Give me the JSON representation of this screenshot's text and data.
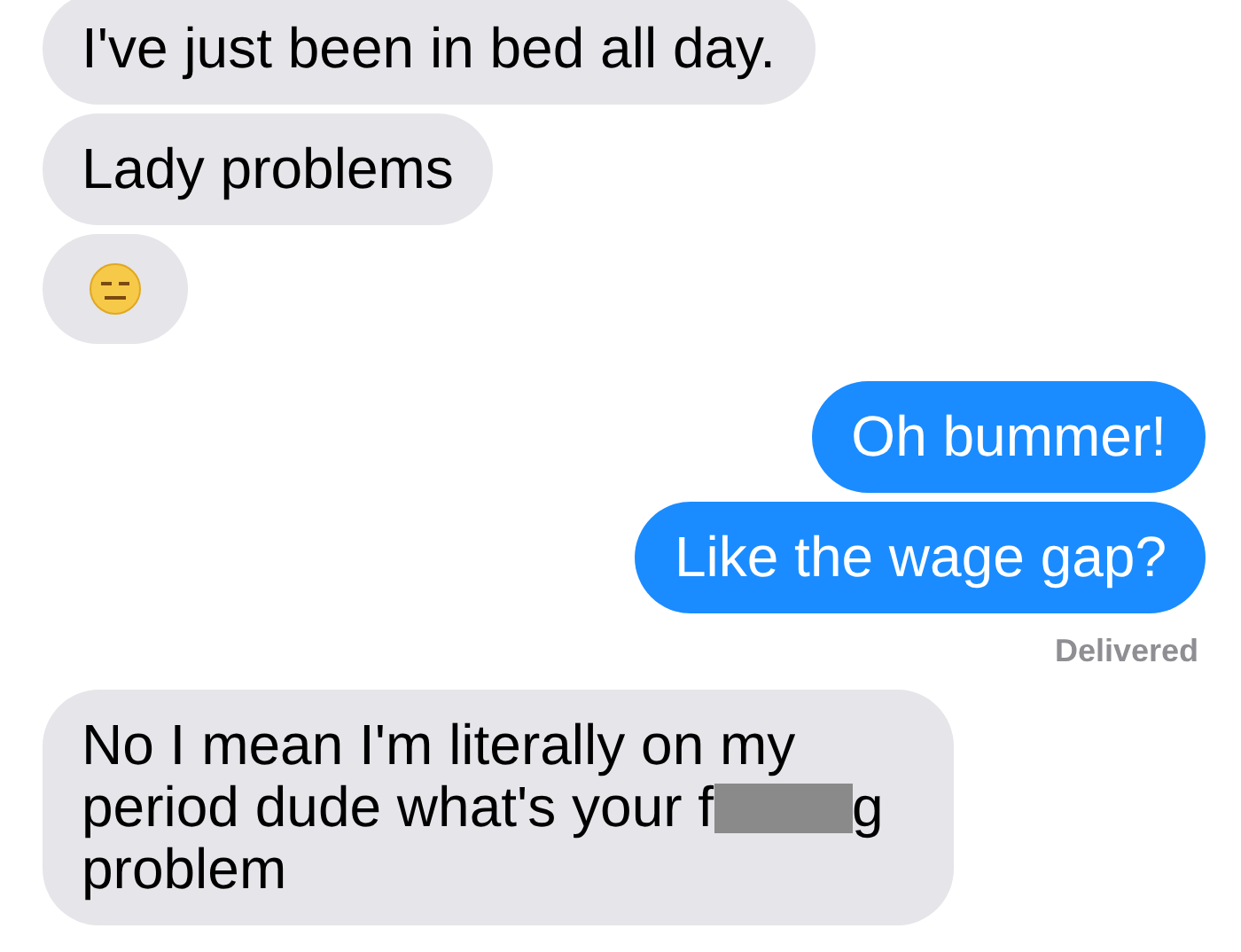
{
  "messages": [
    {
      "kind": "text",
      "outgoing": false,
      "segments": [
        {
          "kind": "text",
          "text": "I've just been in bed all day."
        }
      ]
    },
    {
      "kind": "text",
      "outgoing": false,
      "segments": [
        {
          "kind": "text",
          "text": "Lady problems"
        }
      ]
    },
    {
      "kind": "emoji",
      "outgoing": false
    },
    {
      "kind": "text",
      "outgoing": true,
      "segments": [
        {
          "kind": "text",
          "text": "Oh bummer!"
        }
      ]
    },
    {
      "kind": "text",
      "outgoing": true,
      "segments": [
        {
          "kind": "text",
          "text": "Like the wage gap?"
        }
      ]
    },
    {
      "kind": "status",
      "text": "Delivered"
    },
    {
      "kind": "text",
      "outgoing": false,
      "segments": [
        {
          "kind": "text",
          "text": "No I mean I'm literally on my period dude what's your f"
        },
        {
          "kind": "redacted"
        },
        {
          "kind": "text",
          "text": "g problem"
        }
      ]
    }
  ]
}
